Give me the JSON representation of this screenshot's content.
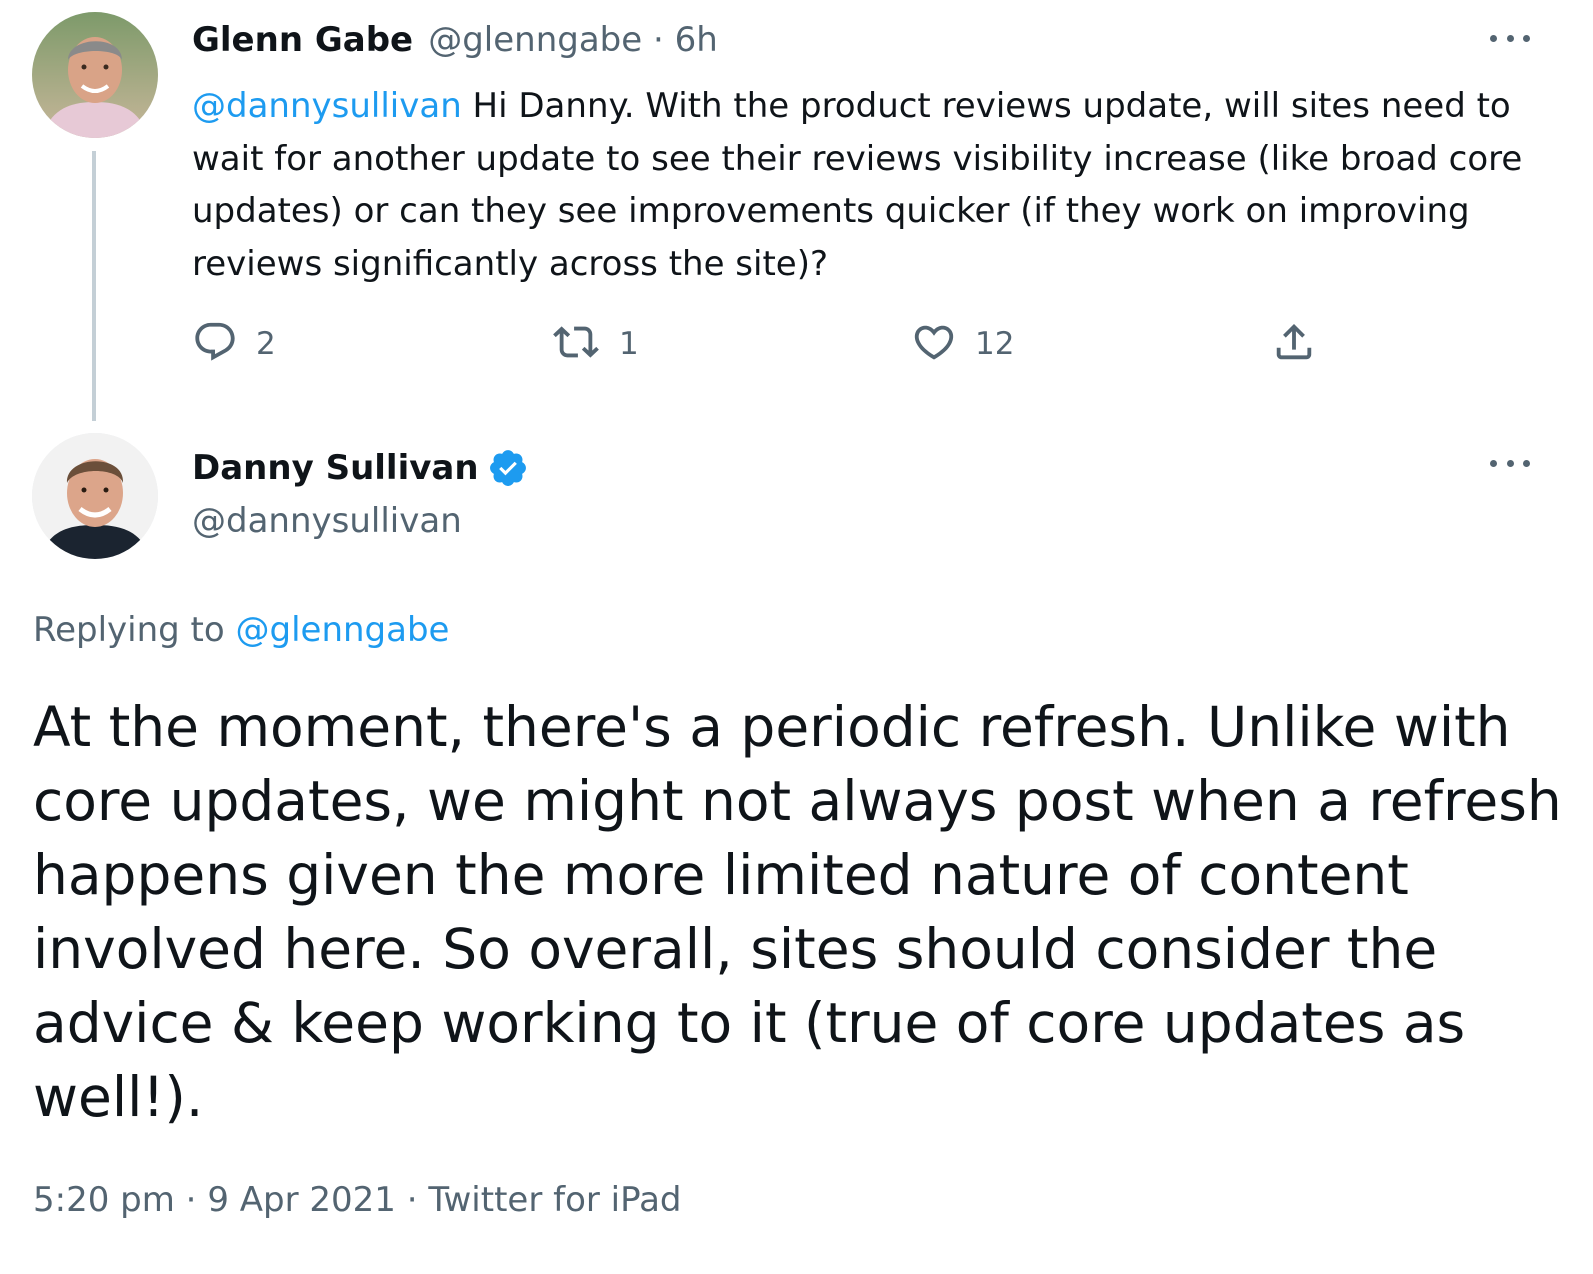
{
  "tweet_parent": {
    "author_name": "Glenn Gabe",
    "author_handle": "@glenngabe",
    "separator": " · ",
    "time": "6h",
    "mention": "@dannysullivan",
    "text": " Hi Danny. With the product reviews update, will sites need to wait for another update to see their reviews visibility increase (like broad core updates) or can they see improvements quicker (if they work on improving reviews significantly across the site)?",
    "actions": {
      "reply_count": "2",
      "retweet_count": "1",
      "like_count": "12"
    }
  },
  "tweet_main": {
    "author_name": "Danny Sullivan",
    "author_handle": "@dannysullivan",
    "verified": true,
    "replying_to_label": "Replying to ",
    "replying_to_handle": "@glenngabe",
    "text": "At the moment, there's a periodic refresh. Unlike with core updates, we might not always post when a refresh happens given the more limited nature of content involved here. So overall, sites should consider the advice & keep working to it (true of core updates as well!).",
    "time": "5:20 pm",
    "separator1": " · ",
    "date": "9 Apr 2021",
    "separator2": " · ",
    "source": "Twitter for iPad"
  },
  "colors": {
    "link": "#1d9bf0",
    "secondary_text": "#536471",
    "primary_text": "#0f1419",
    "thread_line": "#c4cfd6",
    "verified_badge": "#1d9bf0"
  },
  "icons": {
    "reply": "reply-icon",
    "retweet": "retweet-icon",
    "like": "heart-icon",
    "share": "share-icon",
    "more": "more-icon",
    "verified": "verified-badge-icon"
  }
}
